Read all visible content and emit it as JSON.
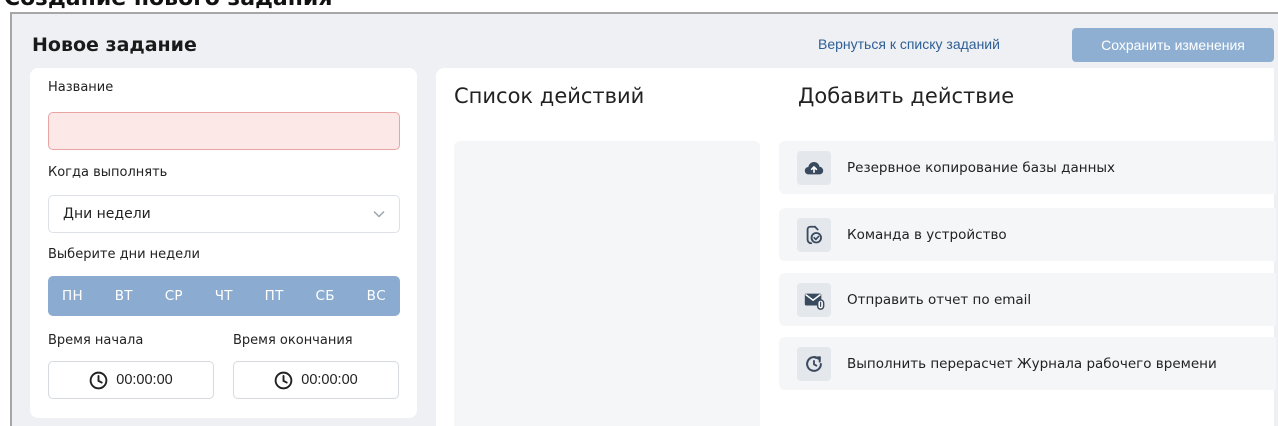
{
  "top_heading": "Создание нового задания",
  "header": {
    "title": "Новое задание",
    "back_link": "Вернуться к списку заданий",
    "save_label": "Сохранить изменения"
  },
  "form": {
    "name_label": "Название",
    "name_value": "",
    "when_label": "Когда выполнять",
    "when_value": "Дни недели",
    "days_label": "Выберите дни недели",
    "days": [
      "ПН",
      "ВТ",
      "СР",
      "ЧТ",
      "ПТ",
      "СБ",
      "ВС"
    ],
    "start_label": "Время начала",
    "end_label": "Время окончания",
    "start_time": "00:00:00",
    "end_time": "00:00:00"
  },
  "actions": {
    "list_title": "Список действий",
    "add_title": "Добавить действие",
    "items": [
      {
        "label": "Резервное копирование базы данных",
        "icon": "cloud-upload-icon"
      },
      {
        "label": "Команда в устройство",
        "icon": "device-command-icon"
      },
      {
        "label": "Отправить отчет по email",
        "icon": "email-report-icon"
      },
      {
        "label": "Выполнить перерасчет Журнала рабочего времени",
        "icon": "recalculate-icon"
      }
    ]
  },
  "colors": {
    "accent": "#8cabd0",
    "save_button": "#8eafd2",
    "link": "#2e5f96",
    "invalid_field": "#fde8e8",
    "icon_dark": "#3a4a5e"
  }
}
